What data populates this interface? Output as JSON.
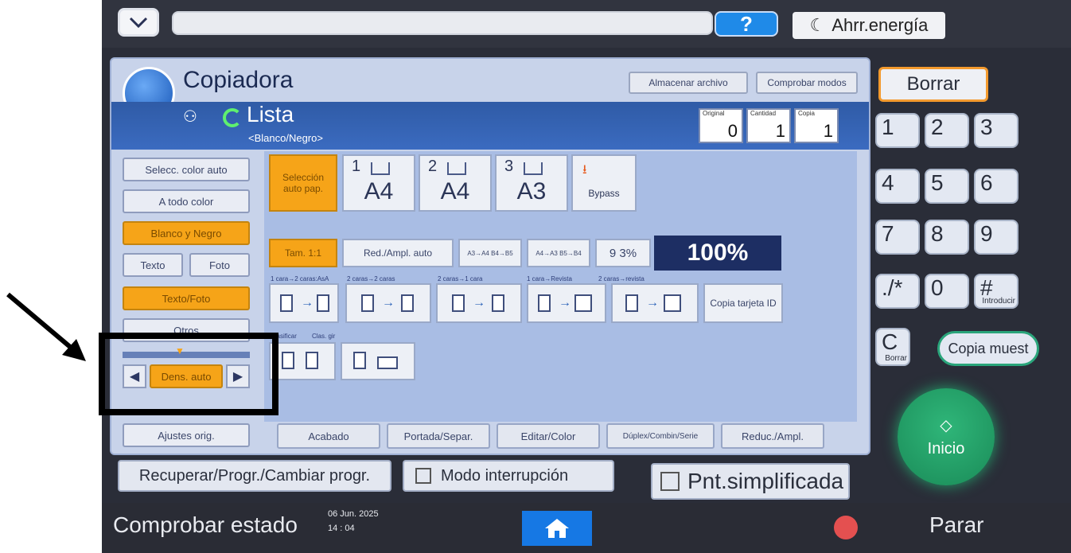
{
  "topbar": {
    "help_label": "?",
    "energy_label": "Ahrr.energía"
  },
  "app": {
    "title": "Copiadora",
    "store_file": "Almacenar archivo",
    "check_modes": "Comprobar modos",
    "status": "Lista",
    "color_mode_line": "<Blanco/Negro>",
    "counters": [
      {
        "label": "Original",
        "value": "0"
      },
      {
        "label": "Cantidad",
        "value": "1"
      },
      {
        "label": "Copia",
        "value": "1"
      }
    ]
  },
  "left_panel": {
    "auto_color": "Selecc. color auto",
    "full_color": "A todo color",
    "black_white": "Blanco y Negro",
    "text": "Texto",
    "photo": "Foto",
    "text_photo": "Texto/Foto",
    "other": "Otros",
    "density_label": "Dens. auto",
    "orig_settings": "Ajustes orig."
  },
  "paper": {
    "auto_select": "Selección auto pap.",
    "trays": [
      {
        "num": "1",
        "size": "A4"
      },
      {
        "num": "2",
        "size": "A4"
      },
      {
        "num": "3",
        "size": "A3"
      }
    ],
    "bypass": "Bypass"
  },
  "zoom": {
    "full_size": "Tam. 1:1",
    "auto_reduce": "Red./Ampl. auto",
    "r1": "A3→A4 B4→B5",
    "r2": "A4→A3 B5→B4",
    "pct93": "9 3%",
    "current": "100%"
  },
  "duplex": {
    "labels": [
      "1 cara→2 caras:AsA",
      "2 caras→2 caras",
      "2 caras→1 cara",
      "1 cara→Revista",
      "2 caras→revista"
    ],
    "id_card": "Copia tarjeta ID",
    "sort_label": "Clasificar",
    "stack_label": "Clas. gir"
  },
  "tabs": [
    "Acabado",
    "Portada/Separ.",
    "Editar/Color",
    "Dúplex/Combin/Serie",
    "Reduc./Ampl."
  ],
  "bottom_row": {
    "recall": "Recuperar/Progr./Cambiar progr.",
    "interrupt": "Modo interrupción",
    "simplified": "Pnt.simplificada"
  },
  "keypad": {
    "clear": "Borrar",
    "keys": [
      "1",
      "2",
      "3",
      "4",
      "5",
      "6",
      "7",
      "8",
      "9",
      "./*",
      "0",
      "#"
    ],
    "enter_label": "Introducir",
    "c_label": "C",
    "c_sub": "Borrar",
    "sample": "Copia muest",
    "start": "Inicio"
  },
  "status_bar": {
    "check_status": "Comprobar estado",
    "date": "06 Jun. 2025",
    "time": "14 : 04",
    "stop": "Parar"
  },
  "colors": {
    "accent_orange": "#f6a418",
    "start_green": "#1f9a5e",
    "help_blue": "#1f8ae8"
  }
}
